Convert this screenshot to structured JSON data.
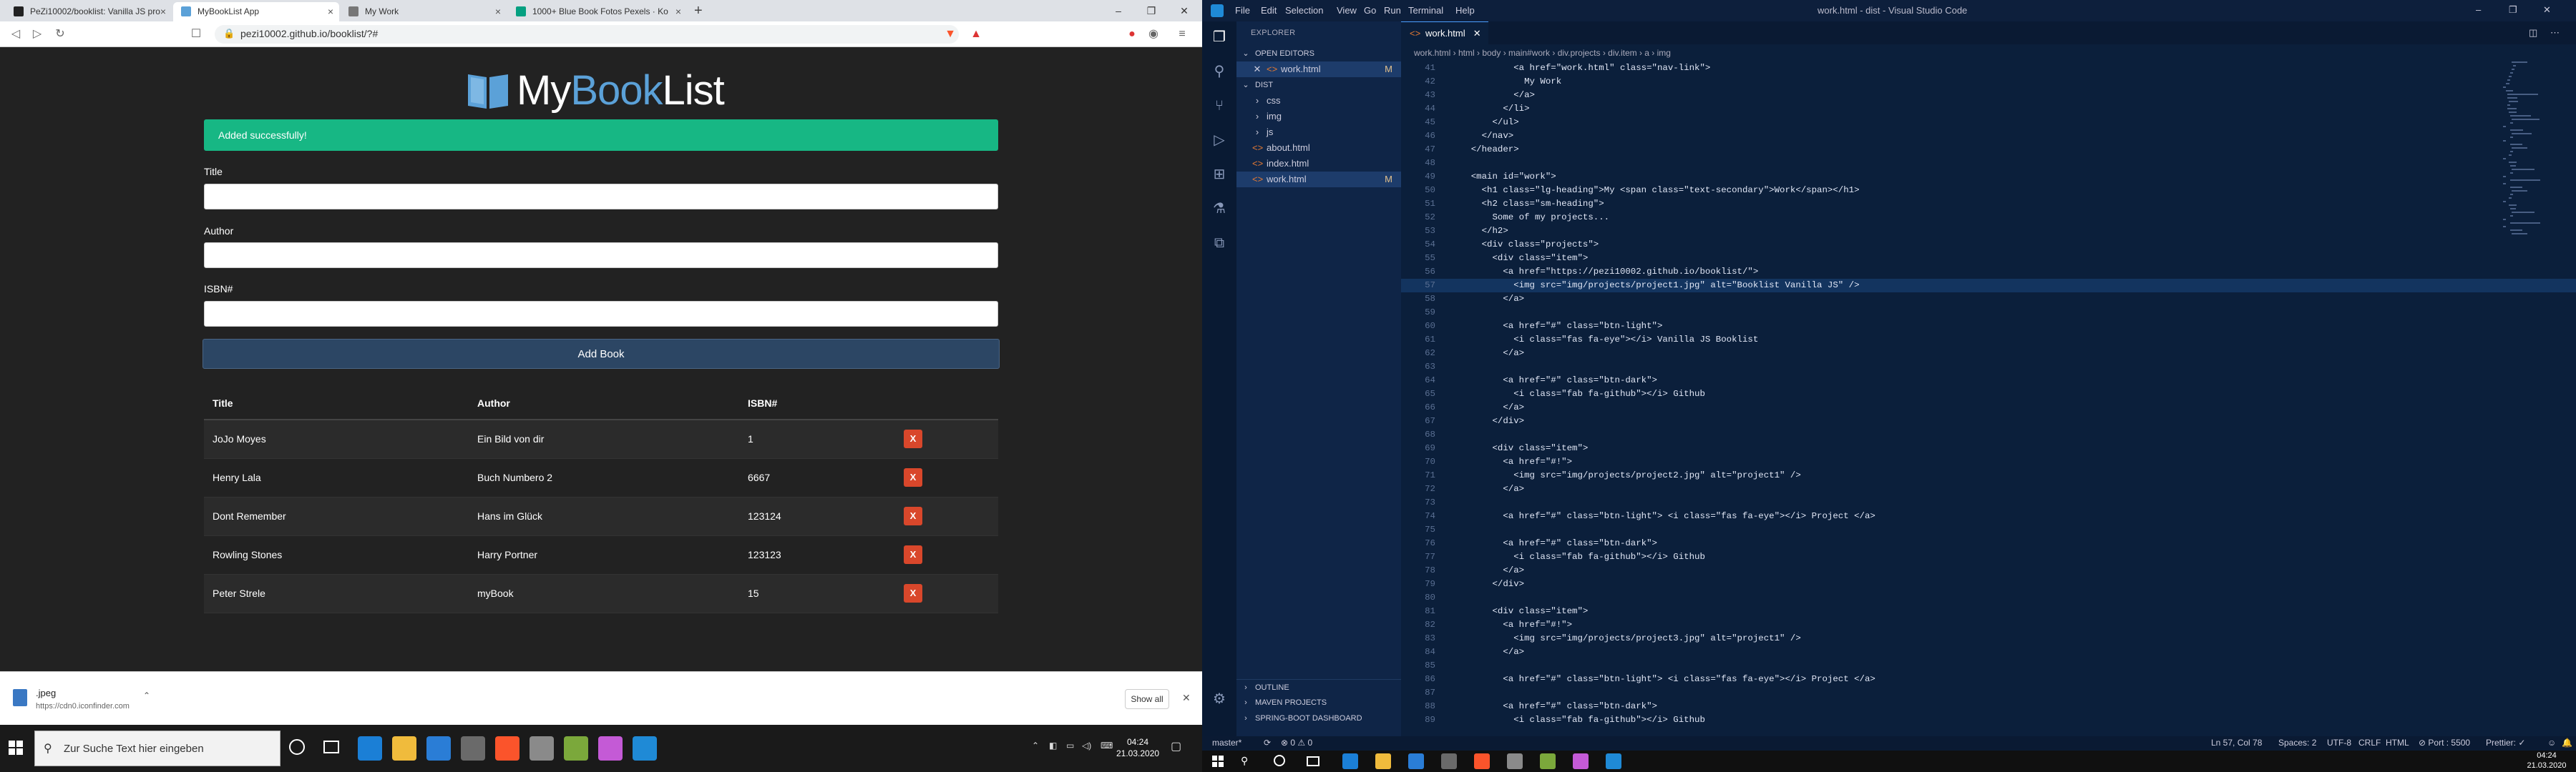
{
  "browser": {
    "tabs": [
      {
        "label": "PeZi10002/booklist: Vanilla JS pro",
        "color": "#222"
      },
      {
        "label": "MyBookList App",
        "color": "#5ba1d8"
      },
      {
        "label": "My Work",
        "color": "#777"
      },
      {
        "label": "1000+ Blue Book Fotos Pexels · Ko",
        "color": "#05a081"
      }
    ],
    "url": "pezi10002.github.io/booklist/?#",
    "window_controls": [
      "–",
      "❐",
      "✕"
    ]
  },
  "app": {
    "logo": {
      "my": "My",
      "book": "Book",
      "list": "List"
    },
    "alert": "Added successfully!",
    "form": {
      "title_label": "Title",
      "author_label": "Author",
      "isbn_label": "ISBN#",
      "submit_label": "Add Book"
    },
    "table": {
      "headers": [
        "Title",
        "Author",
        "ISBN#"
      ],
      "delete_label": "X",
      "rows": [
        {
          "title": "JoJo Moyes",
          "author": "Ein Bild von dir",
          "isbn": "1"
        },
        {
          "title": "Henry Lala",
          "author": "Buch Numbero 2",
          "isbn": "6667"
        },
        {
          "title": "Dont Remember",
          "author": "Hans im Glück",
          "isbn": "123124"
        },
        {
          "title": "Rowling Stones",
          "author": "Harry Portner",
          "isbn": "123123"
        },
        {
          "title": "Peter Strele",
          "author": "myBook",
          "isbn": "15"
        }
      ]
    }
  },
  "download": {
    "name": ".jpeg",
    "url": "https://cdn0.iconfinder.com",
    "show_all": "Show all"
  },
  "taskbar": {
    "search_placeholder": "Zur Suche Text hier eingeben",
    "time": "04:24",
    "date": "21.03.2020"
  },
  "vscode": {
    "menu": [
      "File",
      "Edit",
      "Selection",
      "View",
      "Go",
      "Run",
      "Terminal",
      "Help"
    ],
    "title": "work.html - dist - Visual Studio Code",
    "explorer_label": "EXPLORER",
    "open_editors_label": "OPEN EDITORS",
    "open_editor": {
      "name": "work.html",
      "badge": "M",
      "close": "✕"
    },
    "folder_label": "DIST",
    "tree": [
      {
        "name": "css",
        "type": "folder"
      },
      {
        "name": "img",
        "type": "folder"
      },
      {
        "name": "js",
        "type": "folder"
      },
      {
        "name": "about.html",
        "type": "file"
      },
      {
        "name": "index.html",
        "type": "file"
      },
      {
        "name": "work.html",
        "type": "file",
        "badge": "M"
      }
    ],
    "bottom_panels": [
      "OUTLINE",
      "MAVEN PROJECTS",
      "SPRING-BOOT DASHBOARD"
    ],
    "tab_label": "work.html",
    "tab_close": "✕",
    "breadcrumbs": "work.html  ›  html  ›  body  ›  main#work  ›  div.projects  ›  div.item  ›  a  ›  img",
    "code_lines": [
      {
        "n": "41",
        "t": "            <a href=\"work.html\" class=\"nav-link\">"
      },
      {
        "n": "42",
        "t": "              My Work"
      },
      {
        "n": "43",
        "t": "            </a>"
      },
      {
        "n": "44",
        "t": "          </li>"
      },
      {
        "n": "45",
        "t": "        </ul>"
      },
      {
        "n": "46",
        "t": "      </nav>"
      },
      {
        "n": "47",
        "t": "    </header>"
      },
      {
        "n": "48",
        "t": ""
      },
      {
        "n": "49",
        "t": "    <main id=\"work\">"
      },
      {
        "n": "50",
        "t": "      <h1 class=\"lg-heading\">My <span class=\"text-secondary\">Work</span></h1>"
      },
      {
        "n": "51",
        "t": "      <h2 class=\"sm-heading\">"
      },
      {
        "n": "52",
        "t": "        Some of my projects..."
      },
      {
        "n": "53",
        "t": "      </h2>"
      },
      {
        "n": "54",
        "t": "      <div class=\"projects\">"
      },
      {
        "n": "55",
        "t": "        <div class=\"item\">"
      },
      {
        "n": "56",
        "t": "          <a href=\"https://pezi10002.github.io/booklist/\">"
      },
      {
        "n": "57",
        "t": "            <img src=\"img/projects/project1.jpg\" alt=\"Booklist Vanilla JS\" />"
      },
      {
        "n": "58",
        "t": "          </a>"
      },
      {
        "n": "59",
        "t": ""
      },
      {
        "n": "60",
        "t": "          <a href=\"#\" class=\"btn-light\">"
      },
      {
        "n": "61",
        "t": "            <i class=\"fas fa-eye\"></i> Vanilla JS Booklist"
      },
      {
        "n": "62",
        "t": "          </a>"
      },
      {
        "n": "63",
        "t": ""
      },
      {
        "n": "64",
        "t": "          <a href=\"#\" class=\"btn-dark\">"
      },
      {
        "n": "65",
        "t": "            <i class=\"fab fa-github\"></i> Github"
      },
      {
        "n": "66",
        "t": "          </a>"
      },
      {
        "n": "67",
        "t": "        </div>"
      },
      {
        "n": "68",
        "t": ""
      },
      {
        "n": "69",
        "t": "        <div class=\"item\">"
      },
      {
        "n": "70",
        "t": "          <a href=\"#!\">"
      },
      {
        "n": "71",
        "t": "            <img src=\"img/projects/project2.jpg\" alt=\"project1\" />"
      },
      {
        "n": "72",
        "t": "          </a>"
      },
      {
        "n": "73",
        "t": ""
      },
      {
        "n": "74",
        "t": "          <a href=\"#\" class=\"btn-light\"> <i class=\"fas fa-eye\"></i> Project </a>"
      },
      {
        "n": "75",
        "t": ""
      },
      {
        "n": "76",
        "t": "          <a href=\"#\" class=\"btn-dark\">"
      },
      {
        "n": "77",
        "t": "            <i class=\"fab fa-github\"></i> Github"
      },
      {
        "n": "78",
        "t": "          </a>"
      },
      {
        "n": "79",
        "t": "        </div>"
      },
      {
        "n": "80",
        "t": ""
      },
      {
        "n": "81",
        "t": "        <div class=\"item\">"
      },
      {
        "n": "82",
        "t": "          <a href=\"#!\">"
      },
      {
        "n": "83",
        "t": "            <img src=\"img/projects/project3.jpg\" alt=\"project1\" />"
      },
      {
        "n": "84",
        "t": "          </a>"
      },
      {
        "n": "85",
        "t": ""
      },
      {
        "n": "86",
        "t": "          <a href=\"#\" class=\"btn-light\"> <i class=\"fas fa-eye\"></i> Project </a>"
      },
      {
        "n": "87",
        "t": ""
      },
      {
        "n": "88",
        "t": "          <a href=\"#\" class=\"btn-dark\">"
      },
      {
        "n": "89",
        "t": "            <i class=\"fab fa-github\"></i> Github"
      }
    ],
    "highlight_line": "57",
    "status": {
      "branch": "master*",
      "sync": "⟳",
      "problems": "⊗ 0  ⚠ 0",
      "position": "Ln 57, Col 78",
      "spaces": "Spaces: 2",
      "encoding": "UTF-8",
      "eol": "CRLF",
      "lang": "HTML",
      "port": "⊘ Port : 5500",
      "prettier": "Prettier: ✓"
    }
  },
  "colors": {
    "accent": "#5ba1d8",
    "alert": "#17b784",
    "button": "#2c4664",
    "delete": "#d9472b",
    "vscode_bg": "#0b1f3b"
  }
}
